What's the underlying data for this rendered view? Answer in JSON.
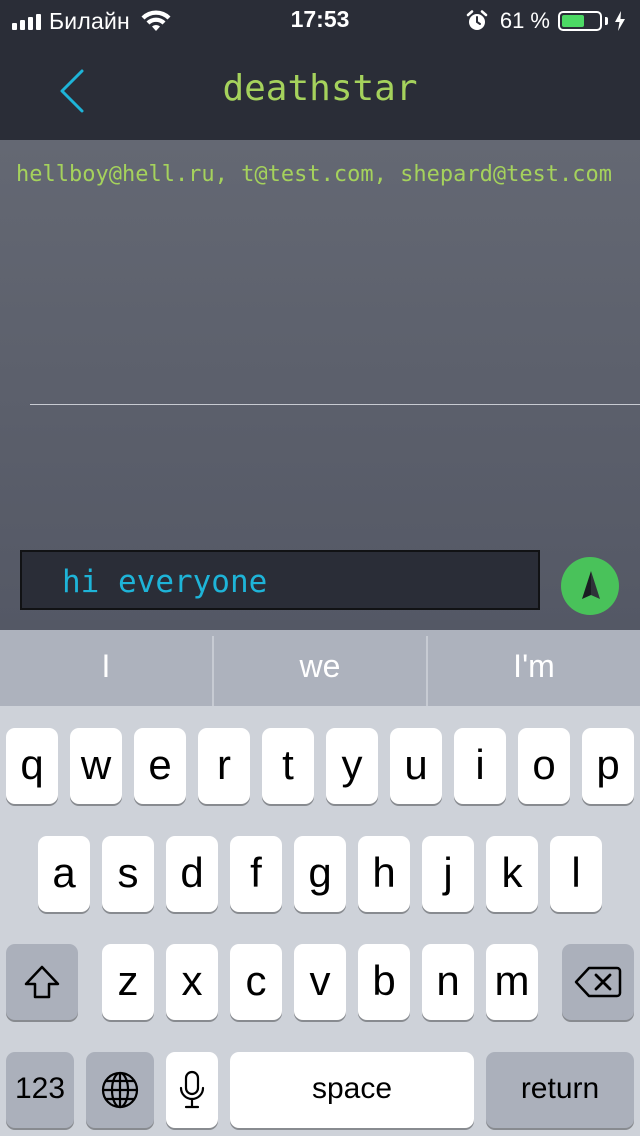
{
  "status_bar": {
    "carrier": "Билайн",
    "time": "17:53",
    "battery_percent": "61 %",
    "battery_level": 0.61,
    "battery_color": "#4cd964"
  },
  "nav": {
    "back_icon": "chevron-left-icon",
    "title": "deathstar"
  },
  "conversation": {
    "recipients": "hellboy@hell.ru, t@test.com, shepard@test.com"
  },
  "composer": {
    "message": "hi everyone",
    "send_icon": "send-arrow-icon",
    "send_color": "#49c25a"
  },
  "keyboard": {
    "suggestions": [
      "I",
      "we",
      "I'm"
    ],
    "row1": [
      "q",
      "w",
      "e",
      "r",
      "t",
      "y",
      "u",
      "i",
      "o",
      "p"
    ],
    "row2": [
      "a",
      "s",
      "d",
      "f",
      "g",
      "h",
      "j",
      "k",
      "l"
    ],
    "row3": [
      "z",
      "x",
      "c",
      "v",
      "b",
      "n",
      "m"
    ],
    "numbers_label": "123",
    "space_label": "space",
    "return_label": "return"
  },
  "colors": {
    "accent_green": "#a5d25c",
    "accent_blue": "#1eb4d8",
    "background_dark": "#2a2d37"
  }
}
